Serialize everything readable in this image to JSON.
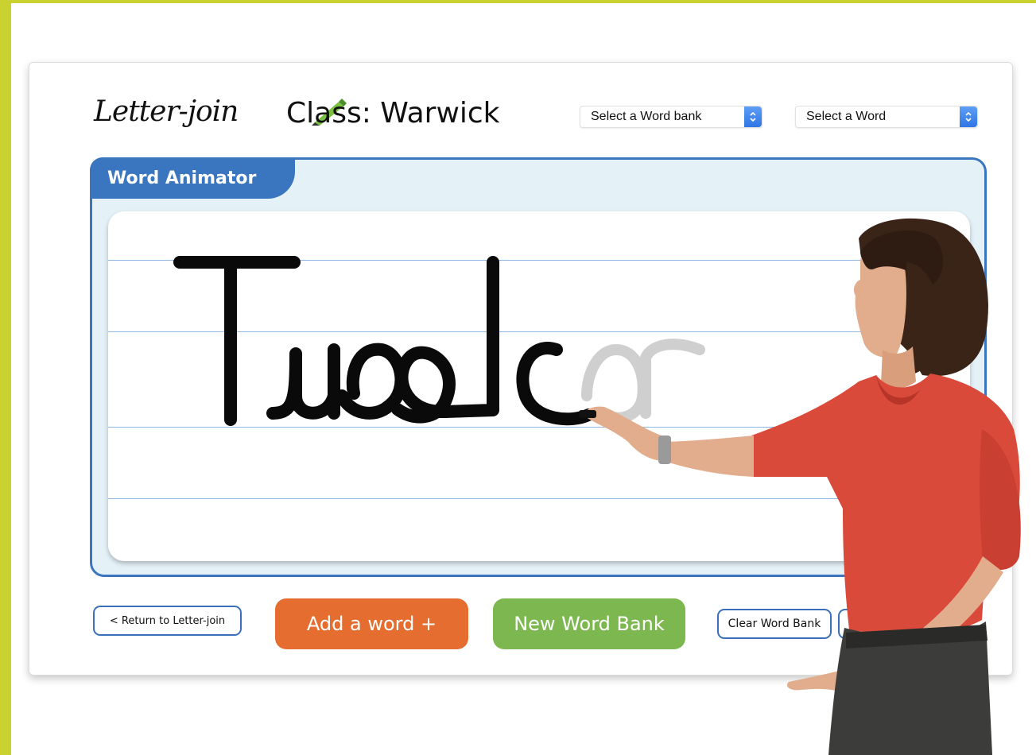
{
  "brand": {
    "logo_text": "Letter-join"
  },
  "header": {
    "class_title": "Class: Warwick"
  },
  "selects": {
    "word_bank": "Select a Word bank",
    "word": "Select a Word"
  },
  "panel": {
    "title": "Word Animator"
  },
  "animation": {
    "word": "Tudor",
    "written_part": "Tudo",
    "remaining_part": "r"
  },
  "buttons": {
    "return": "< Return to Letter-join",
    "add_word": "Add a word +",
    "new_word_bank": "New Word Bank",
    "clear_word_bank": "Clear Word Bank"
  },
  "colors": {
    "frame": "#c9d231",
    "accent_blue": "#3a76c0",
    "add_word": "#e46d2f",
    "new_word_bank": "#7cb84f"
  }
}
